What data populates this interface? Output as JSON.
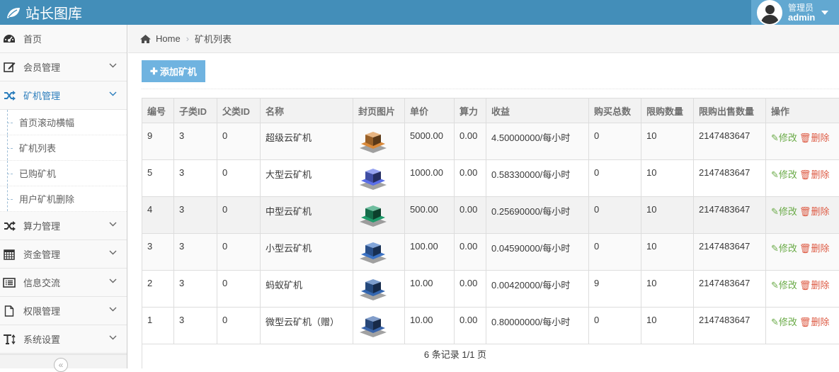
{
  "app": {
    "title": "站长图库"
  },
  "user": {
    "role": "管理员",
    "name": "admin"
  },
  "sidebar": {
    "items": [
      {
        "label": "首页"
      },
      {
        "label": "会员管理"
      },
      {
        "label": "矿机管理"
      },
      {
        "label": "算力管理"
      },
      {
        "label": "资金管理"
      },
      {
        "label": "信息交流"
      },
      {
        "label": "权限管理"
      },
      {
        "label": "系统设置"
      }
    ],
    "submenu": [
      "首页滚动横幅",
      "矿机列表",
      "已购矿机",
      "用户矿机删除"
    ]
  },
  "breadcrumb": {
    "home": "Home",
    "current": "矿机列表"
  },
  "toolbar": {
    "add_label": "添加矿机"
  },
  "table": {
    "headers": [
      "编号",
      "子类ID",
      "父类ID",
      "名称",
      "封页图片",
      "单价",
      "算力",
      "收益",
      "购买总数",
      "限购数量",
      "限购出售数量",
      "操作"
    ],
    "rows": [
      {
        "id": "9",
        "sub": "3",
        "parent": "0",
        "name": "超级云矿机",
        "color": "#d9893a",
        "price": "5000.00",
        "power": "0.00",
        "income": "4.50000000/每小时",
        "total": "0",
        "limit": "10",
        "sale_limit": "2147483647"
      },
      {
        "id": "5",
        "sub": "3",
        "parent": "0",
        "name": "大型云矿机",
        "color": "#5a6ee8",
        "price": "1000.00",
        "power": "0.00",
        "income": "0.58330000/每小时",
        "total": "0",
        "limit": "10",
        "sale_limit": "2147483647"
      },
      {
        "id": "4",
        "sub": "3",
        "parent": "0",
        "name": "中型云矿机",
        "color": "#1e9a6a",
        "price": "500.00",
        "power": "0.00",
        "income": "0.25690000/每小时",
        "total": "0",
        "limit": "10",
        "sale_limit": "2147483647"
      },
      {
        "id": "3",
        "sub": "3",
        "parent": "0",
        "name": "小型云矿机",
        "color": "#3b72c4",
        "price": "100.00",
        "power": "0.00",
        "income": "0.04590000/每小时",
        "total": "0",
        "limit": "10",
        "sale_limit": "2147483647"
      },
      {
        "id": "2",
        "sub": "3",
        "parent": "0",
        "name": "蚂蚁矿机",
        "color": "#3366b0",
        "price": "10.00",
        "power": "0.00",
        "income": "0.00420000/每小时",
        "total": "9",
        "limit": "10",
        "sale_limit": "2147483647"
      },
      {
        "id": "1",
        "sub": "3",
        "parent": "0",
        "name": "微型云矿机（赠）",
        "color": "#3a65ab",
        "price": "10.00",
        "power": "0.00",
        "income": "0.80000000/每小时",
        "total": "0",
        "limit": "10",
        "sale_limit": "2147483647"
      }
    ],
    "edit_label": "修改",
    "delete_label": "删除"
  },
  "pagination": {
    "summary": "6 条记录 1/1 页"
  }
}
